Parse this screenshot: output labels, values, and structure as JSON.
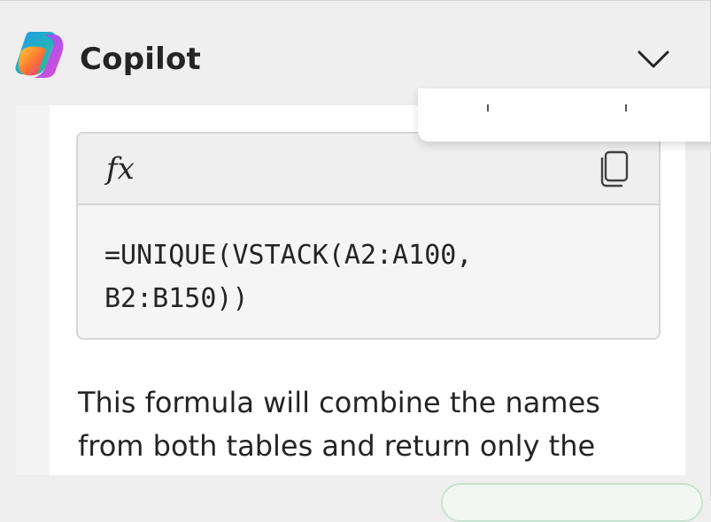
{
  "header": {
    "app_name": "Copilot",
    "logo_icon": "copilot-logo-icon",
    "collapse_icon": "chevron-down-icon"
  },
  "code_block": {
    "fx_label": "fx",
    "copy_icon": "copy-icon",
    "formula": "=UNIQUE(VSTACK(A2:A100,\nB2:B150))"
  },
  "message": {
    "text": "This formula will combine the names from both tables and return only the"
  },
  "colors": {
    "background": "#efefef",
    "card": "#ffffff",
    "code_header": "#efefef",
    "code_body": "#f5f5f5",
    "border": "#d5d5d5",
    "text": "#242424"
  }
}
